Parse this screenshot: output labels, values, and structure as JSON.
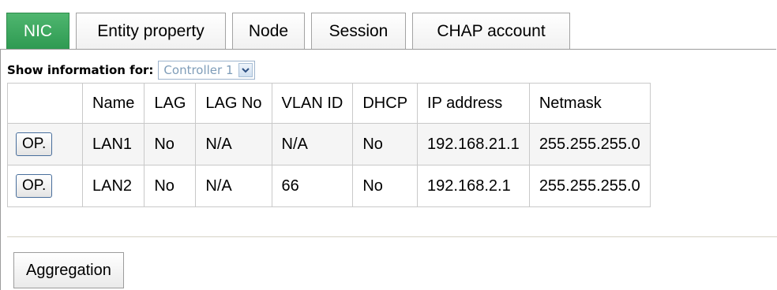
{
  "tabs": [
    {
      "label": "NIC",
      "active": true
    },
    {
      "label": "Entity property",
      "active": false
    },
    {
      "label": "Node",
      "active": false
    },
    {
      "label": "Session",
      "active": false
    },
    {
      "label": "CHAP account",
      "active": false
    }
  ],
  "filter": {
    "label": "Show information for:",
    "selected": "Controller 1",
    "arrow_icon": "chevron-down-icon"
  },
  "table": {
    "headers": [
      "",
      "Name",
      "LAG",
      "LAG No",
      "VLAN ID",
      "DHCP",
      "IP address",
      "Netmask"
    ],
    "rows": [
      {
        "op": "OP.",
        "name": "LAN1",
        "lag": "No",
        "lag_no": "N/A",
        "vlan_id": "N/A",
        "dhcp": "No",
        "ip": "192.168.21.1",
        "netmask": "255.255.255.0"
      },
      {
        "op": "OP.",
        "name": "LAN2",
        "lag": "No",
        "lag_no": "N/A",
        "vlan_id": "66",
        "dhcp": "No",
        "ip": "192.168.2.1",
        "netmask": "255.255.255.0"
      }
    ]
  },
  "actions": {
    "aggregation_label": "Aggregation"
  },
  "colors": {
    "active_tab": "#3aa85e",
    "border": "#9c9c9c"
  }
}
